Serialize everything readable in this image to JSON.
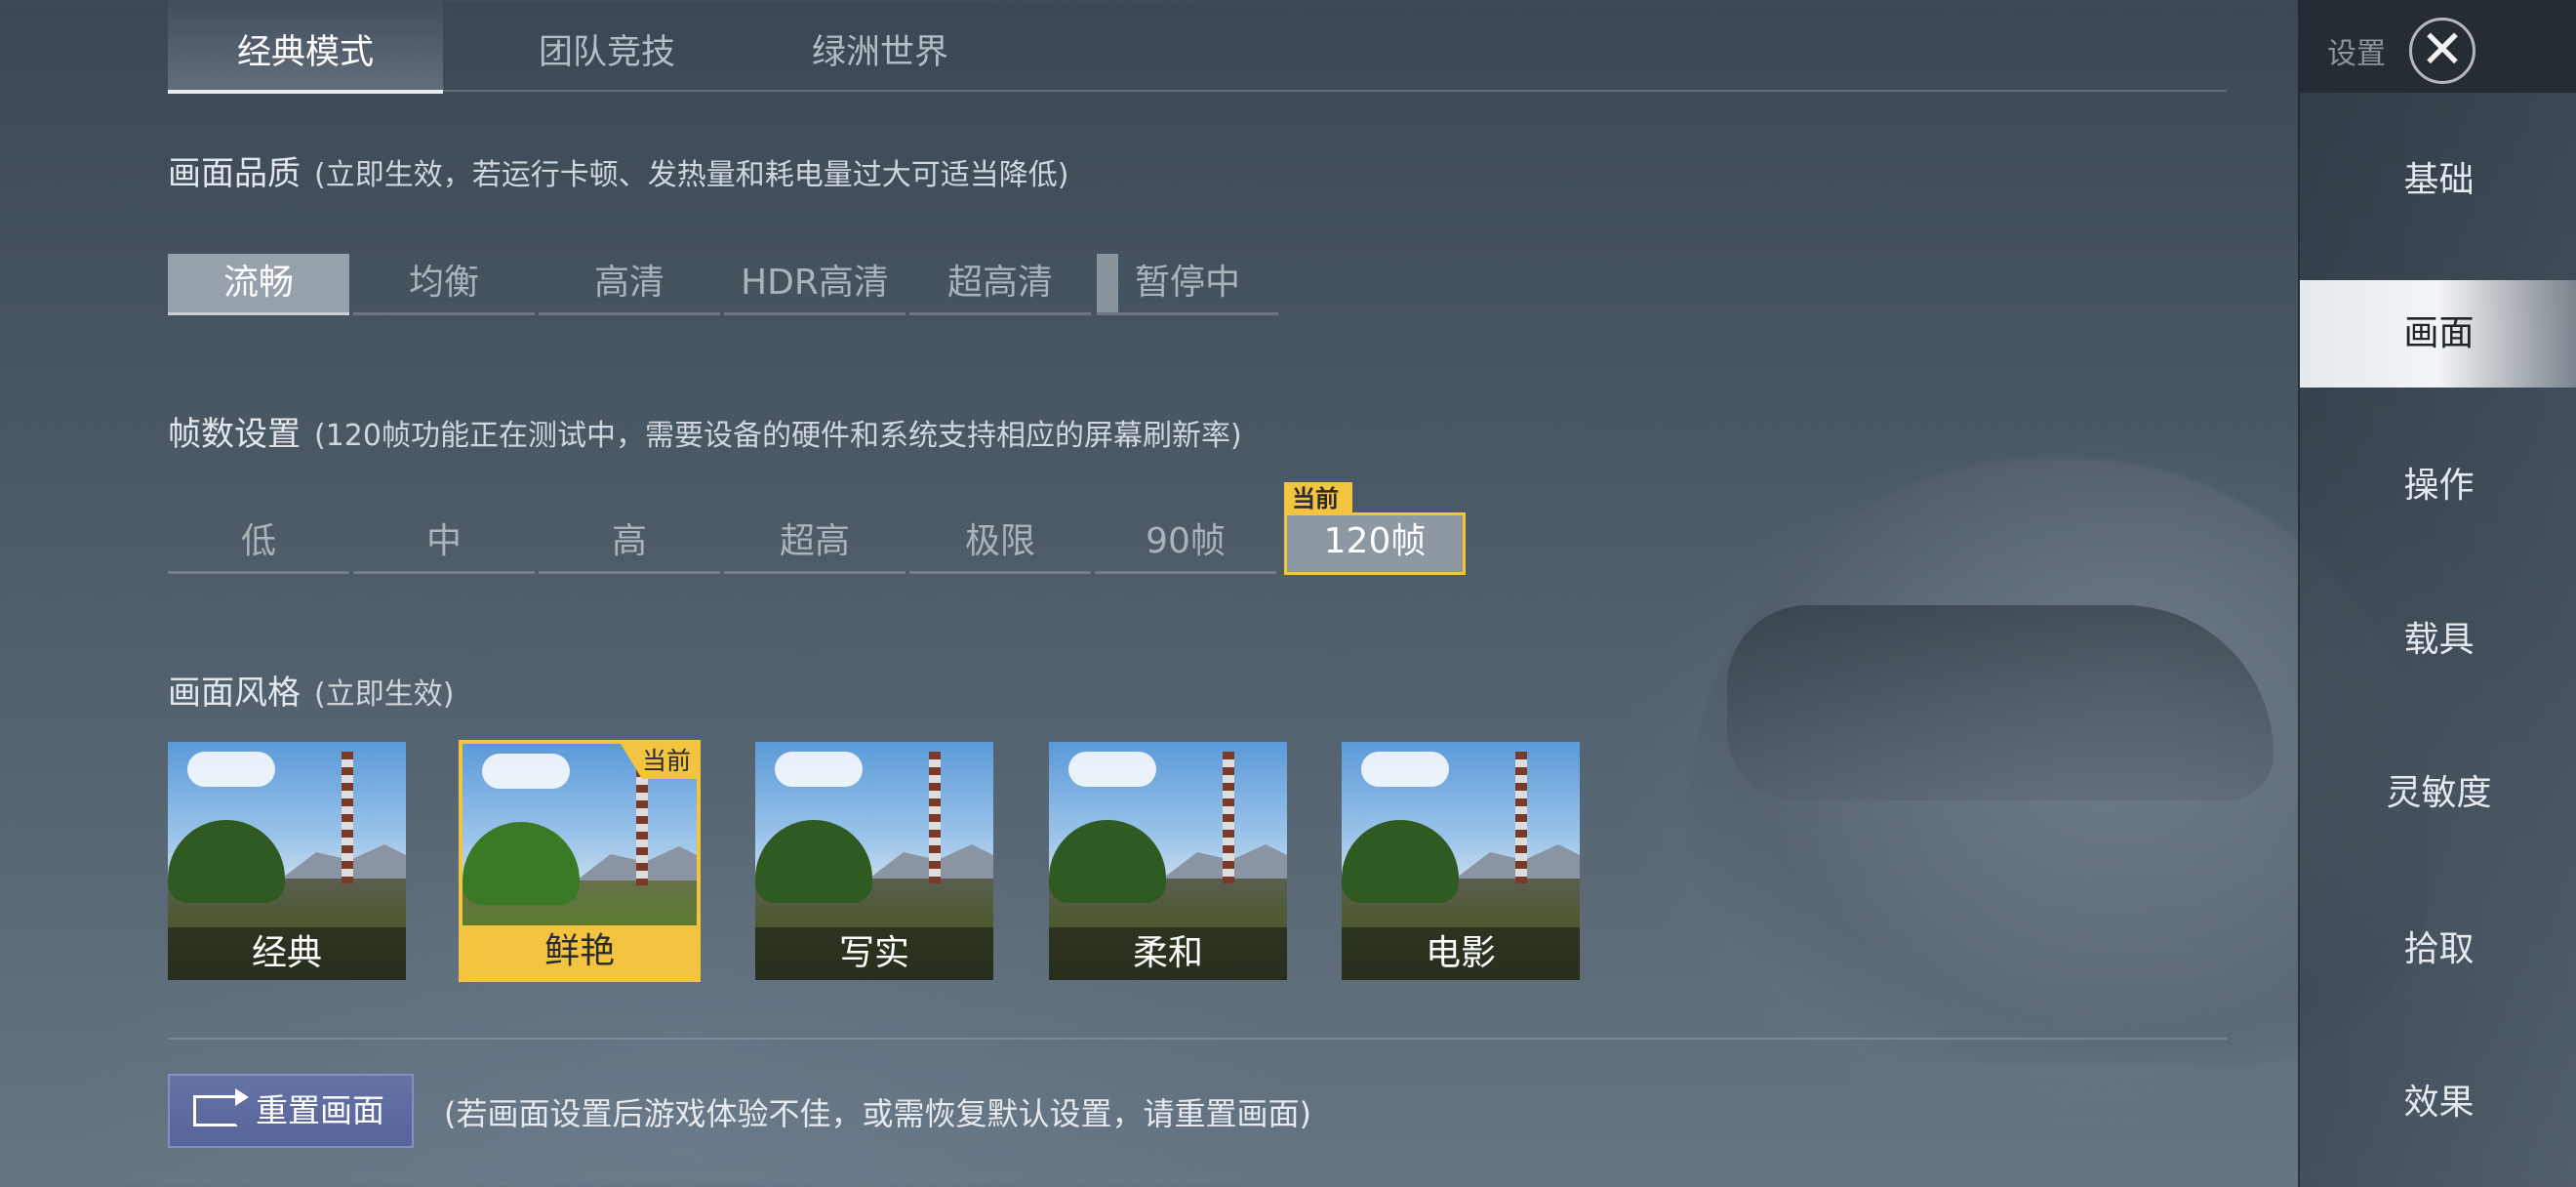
{
  "tabs": [
    "经典模式",
    "团队竞技",
    "绿洲世界"
  ],
  "sidebar": {
    "header_label": "设置",
    "items": [
      "基础",
      "画面",
      "操作",
      "载具",
      "灵敏度",
      "拾取",
      "效果"
    ]
  },
  "quality": {
    "title": "画面品质",
    "note": "(立即生效，若运行卡顿、发热量和耗电量过大可适当降低)",
    "options": [
      "流畅",
      "均衡",
      "高清",
      "HDR高清",
      "超高清",
      "暂停中"
    ],
    "selected": "流畅"
  },
  "fps": {
    "title": "帧数设置",
    "note": "(120帧功能正在测试中，需要设备的硬件和系统支持相应的屏幕刷新率)",
    "options": [
      "低",
      "中",
      "高",
      "超高",
      "极限",
      "90帧",
      "120帧"
    ],
    "current_tag": "当前",
    "selected": "120帧"
  },
  "style": {
    "title": "画面风格",
    "note": "(立即生效)",
    "options": [
      "经典",
      "鲜艳",
      "写实",
      "柔和",
      "电影"
    ],
    "current_tag": "当前",
    "selected": "鲜艳"
  },
  "reset": {
    "button_label": "重置画面",
    "note": "(若画面设置后游戏体验不佳，或需恢复默认设置，请重置画面)"
  },
  "colors": {
    "accent_yellow": "#f2c440",
    "reset_button": "#5f6ba0"
  },
  "icons": [
    "close-icon",
    "reset-icon"
  ]
}
